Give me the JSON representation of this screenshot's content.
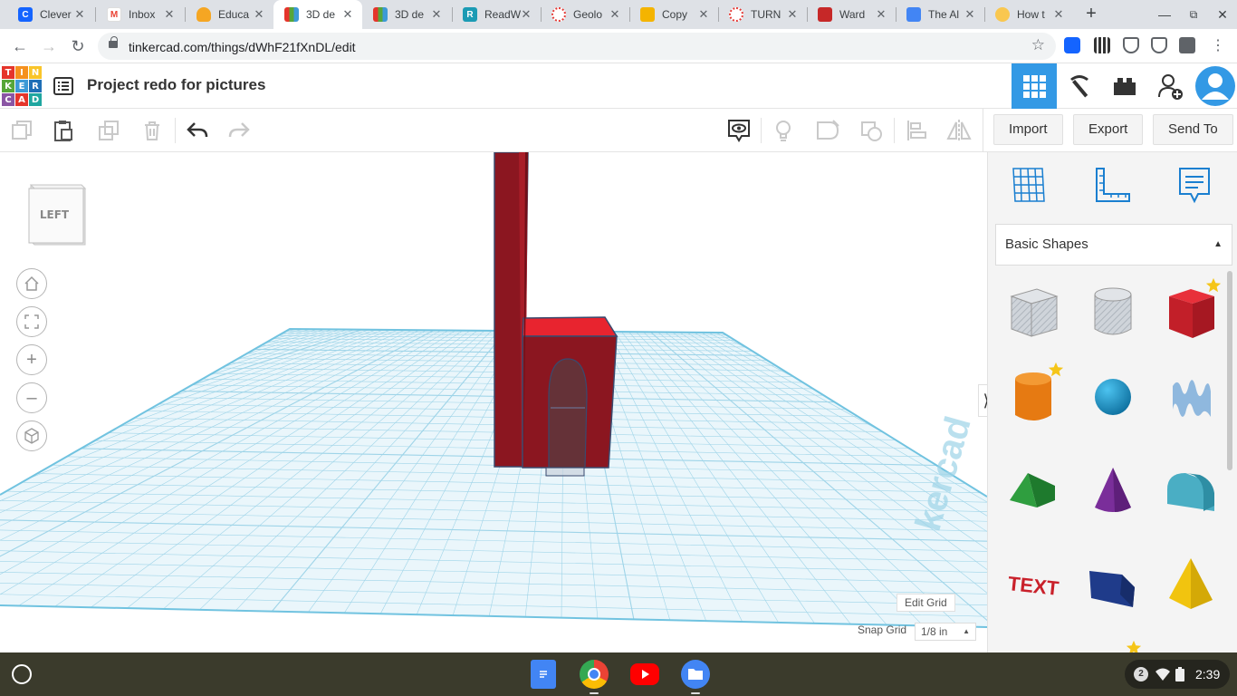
{
  "browser": {
    "tabs": [
      {
        "title": "Clever",
        "icon": "clever-icon",
        "color": "#1464ff",
        "glyph": "C"
      },
      {
        "title": "Inbox",
        "icon": "gmail-icon",
        "color": "#ea4335",
        "glyph": "M"
      },
      {
        "title": "Educa",
        "icon": "edpuzzle-icon",
        "color": "#f5a623",
        "glyph": ""
      },
      {
        "title": "3D de",
        "icon": "tinkercad-icon",
        "color": "#ffffff",
        "glyph": "",
        "active": true
      },
      {
        "title": "3D de",
        "icon": "tinkercad-icon",
        "color": "#ffffff",
        "glyph": ""
      },
      {
        "title": "ReadW",
        "icon": "readworks-icon",
        "color": "#1b9bb4",
        "glyph": "R"
      },
      {
        "title": "Geolo",
        "icon": "quizizz-icon",
        "color": "#e53935",
        "glyph": ""
      },
      {
        "title": "Copy",
        "icon": "slides-icon",
        "color": "#f4b400",
        "glyph": ""
      },
      {
        "title": "TURN",
        "icon": "quizizz-icon",
        "color": "#e53935",
        "glyph": ""
      },
      {
        "title": "Ward",
        "icon": "docs-red-icon",
        "color": "#c62828",
        "glyph": ""
      },
      {
        "title": "The Al",
        "icon": "docs-icon",
        "color": "#4285f4",
        "glyph": ""
      },
      {
        "title": "How t",
        "icon": "emoji-face-icon",
        "color": "#f9c74f",
        "glyph": ""
      }
    ],
    "new_tab": "+",
    "url": "tinkercad.com/things/dWhF21fXnDL/edit"
  },
  "app": {
    "logo_letters": [
      "T",
      "I",
      "N",
      "K",
      "E",
      "R",
      "C",
      "A",
      "D"
    ],
    "logo_colors": [
      "#e5352b",
      "#f5911e",
      "#f9c52a",
      "#57a639",
      "#3d9ad6",
      "#1f6fb6",
      "#8a55a4",
      "#e5352b",
      "#1fa6a0"
    ],
    "project_title": "Project redo for pictures"
  },
  "toolbar": {
    "import": "Import",
    "export": "Export",
    "send_to": "Send To"
  },
  "workspace": {
    "view_cube_face": "LEFT",
    "edit_grid": "Edit Grid",
    "snap_grid_label": "Snap Grid",
    "snap_grid_value": "1/8 in"
  },
  "panel": {
    "category": "Basic Shapes",
    "shapes": [
      {
        "name": "Box (hole)",
        "icon": "box-hole-icon"
      },
      {
        "name": "Cylinder (hole)",
        "icon": "cylinder-hole-icon"
      },
      {
        "name": "Box",
        "icon": "box-icon",
        "favorite": true
      },
      {
        "name": "Cylinder",
        "icon": "cylinder-icon",
        "favorite": true
      },
      {
        "name": "Sphere",
        "icon": "sphere-icon"
      },
      {
        "name": "Scribble",
        "icon": "scribble-icon"
      },
      {
        "name": "Roof",
        "icon": "roof-icon"
      },
      {
        "name": "Cone",
        "icon": "cone-icon"
      },
      {
        "name": "Round Roof",
        "icon": "round-roof-icon"
      },
      {
        "name": "Text",
        "icon": "text-icon"
      },
      {
        "name": "Wedge",
        "icon": "wedge-icon"
      },
      {
        "name": "Pyramid",
        "icon": "pyramid-icon"
      }
    ]
  },
  "system": {
    "notification_count": "2",
    "time": "2:39"
  }
}
